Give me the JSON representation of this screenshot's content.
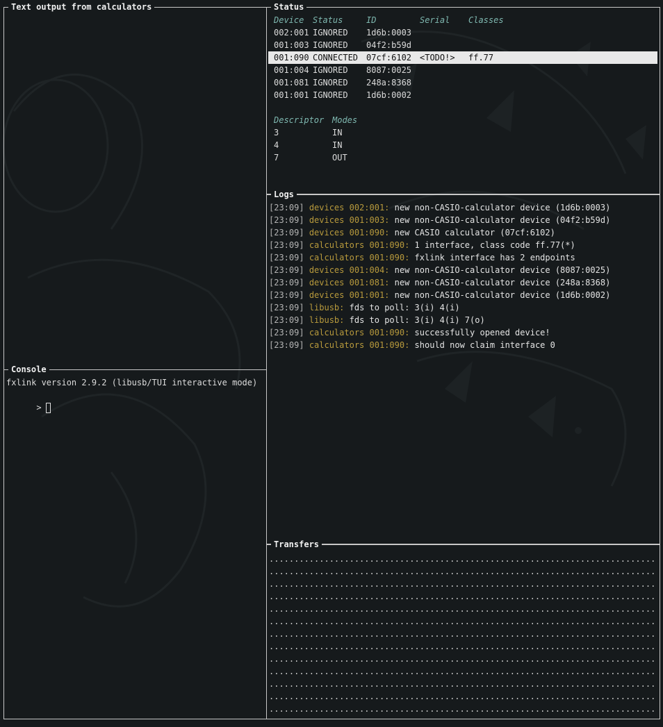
{
  "panels": {
    "text_output": {
      "title": "Text output from calculators"
    },
    "console": {
      "title": "Console",
      "version_line": "fxlink version 2.9.2 (libusb/TUI interactive mode)",
      "prompt": ">"
    },
    "status": {
      "title": "Status"
    },
    "logs": {
      "title": "Logs"
    },
    "transfers": {
      "title": "Transfers"
    }
  },
  "devices": {
    "headers": [
      "Device",
      "Status",
      "ID",
      "Serial",
      "Classes"
    ],
    "rows": [
      {
        "device": "002:001",
        "status": "IGNORED",
        "id": "1d6b:0003",
        "serial": "",
        "classes": "",
        "selected": false
      },
      {
        "device": "001:003",
        "status": "IGNORED",
        "id": "04f2:b59d",
        "serial": "",
        "classes": "",
        "selected": false
      },
      {
        "device": "001:090",
        "status": "CONNECTED",
        "id": "07cf:6102",
        "serial": "<TODO!>",
        "classes": "ff.77",
        "selected": true
      },
      {
        "device": "001:004",
        "status": "IGNORED",
        "id": "8087:0025",
        "serial": "",
        "classes": "",
        "selected": false
      },
      {
        "device": "001:081",
        "status": "IGNORED",
        "id": "248a:8368",
        "serial": "",
        "classes": "",
        "selected": false
      },
      {
        "device": "001:001",
        "status": "IGNORED",
        "id": "1d6b:0002",
        "serial": "",
        "classes": "",
        "selected": false
      }
    ]
  },
  "descriptors": {
    "headers": [
      "Descriptor",
      "Modes"
    ],
    "rows": [
      {
        "descriptor": "3",
        "mode": "IN"
      },
      {
        "descriptor": "4",
        "mode": "IN"
      },
      {
        "descriptor": "7",
        "mode": "OUT"
      }
    ]
  },
  "logs": [
    {
      "time": "[23:09]",
      "source": "devices 002:001:",
      "message": "new non-CASIO-calculator device (1d6b:0003)"
    },
    {
      "time": "[23:09]",
      "source": "devices 001:003:",
      "message": "new non-CASIO-calculator device (04f2:b59d)"
    },
    {
      "time": "[23:09]",
      "source": "devices 001:090:",
      "message": "new CASIO calculator (07cf:6102)"
    },
    {
      "time": "[23:09]",
      "source": "calculators 001:090:",
      "message": "1 interface, class code ff.77(*)"
    },
    {
      "time": "[23:09]",
      "source": "calculators 001:090:",
      "message": "fxlink interface has 2 endpoints"
    },
    {
      "time": "[23:09]",
      "source": "devices 001:004:",
      "message": "new non-CASIO-calculator device (8087:0025)"
    },
    {
      "time": "[23:09]",
      "source": "devices 001:081:",
      "message": "new non-CASIO-calculator device (248a:8368)"
    },
    {
      "time": "[23:09]",
      "source": "devices 001:001:",
      "message": "new non-CASIO-calculator device (1d6b:0002)"
    },
    {
      "time": "[23:09]",
      "source": "libusb:",
      "message": "fds to poll: 3(i) 4(i)"
    },
    {
      "time": "[23:09]",
      "source": "libusb:",
      "message": "fds to poll: 3(i) 4(i) 7(o)"
    },
    {
      "time": "[23:09]",
      "source": "calculators 001:090:",
      "message": "successfully opened device!"
    },
    {
      "time": "[23:09]",
      "source": "calculators 001:090:",
      "message": "should now claim interface 0"
    }
  ],
  "transfers": {
    "rows": [
      "..............................................................................",
      "..............................................................................",
      "..............................................................................",
      "..............................................................................",
      "..............................................................................",
      "..............................................................................",
      "..............................................................................",
      "..............................................................................",
      "..............................................................................",
      "..............................................................................",
      "..............................................................................",
      "..............................................................................",
      ".............................................................................."
    ]
  },
  "colors": {
    "border": "#c8c8c8",
    "header_accent": "#7fb8b0",
    "log_source": "#b89a3c",
    "selection_bg": "#e8e8e8"
  }
}
